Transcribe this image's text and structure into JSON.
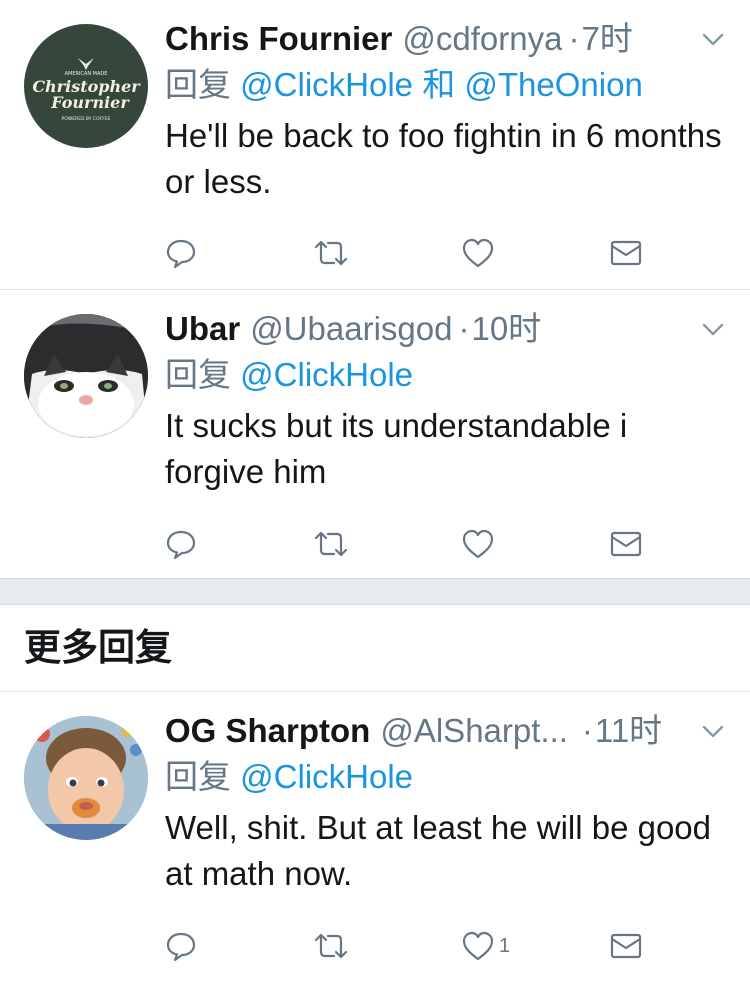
{
  "colors": {
    "link": "#1b95e0",
    "secondary": "#657786",
    "divider": "#e1e8ed"
  },
  "tweets": [
    {
      "name": "Chris Fournier",
      "handle": "@cdfornya",
      "dot": "·",
      "time": "7时",
      "reply_prefix": "回复",
      "mentions": [
        "@ClickHole",
        "@TheOnion"
      ],
      "mention_joiner": "和",
      "text": "He'll be back to foo fightin in 6 months or less.",
      "avatar": {
        "top": "AMERICAN MADE",
        "line1": "Christopher",
        "line2": "Fournier",
        "bottom": "POWERED BY COFFEE"
      },
      "like_count": ""
    },
    {
      "name": "Ubar",
      "handle": "@Ubaarisgod",
      "dot": "·",
      "time": "10时",
      "reply_prefix": "回复",
      "mentions": [
        "@ClickHole"
      ],
      "text": "It sucks but its understandable i forgive him",
      "like_count": ""
    },
    {
      "name": "OG Sharpton",
      "handle": "@AlSharpt...",
      "dot": "·",
      "time": "11时",
      "reply_prefix": "回复",
      "mentions": [
        "@ClickHole"
      ],
      "text": "Well, shit.  But at least he will be good at math now.",
      "like_count": "1"
    }
  ],
  "more_replies_title": "更多回复",
  "icons": [
    "reply-icon",
    "retweet-icon",
    "like-icon",
    "message-icon",
    "chevron-down-icon"
  ]
}
